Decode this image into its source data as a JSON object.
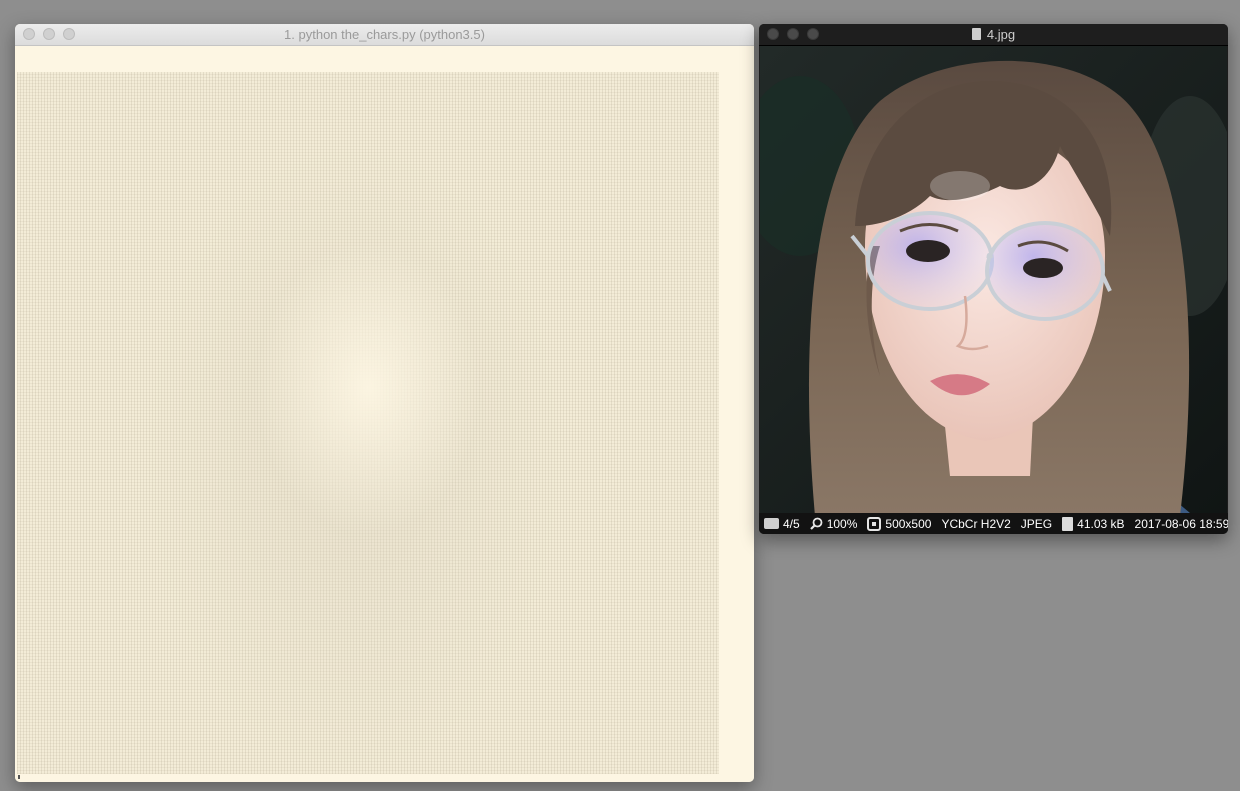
{
  "terminal": {
    "title": "1. python the_chars.py (python3.5)"
  },
  "viewer": {
    "title": "4.jpg",
    "status": {
      "index": "4/5",
      "zoom": "100%",
      "dimensions": "500x500",
      "color_space": "YCbCr H2V2",
      "format": "JPEG",
      "file_size": "41.03 kB",
      "datetime": "2017-08-06 18:59"
    }
  },
  "icons": {
    "folder": "folder-icon",
    "zoom": "magnifier-icon",
    "fit": "fit-to-window-icon",
    "file": "file-icon",
    "more": "chevron-right-icon"
  },
  "colors": {
    "desktop": "#8e8e8e",
    "terminal_bg": "#fdf6e3",
    "viewer_bg": "#1c1c1c"
  }
}
